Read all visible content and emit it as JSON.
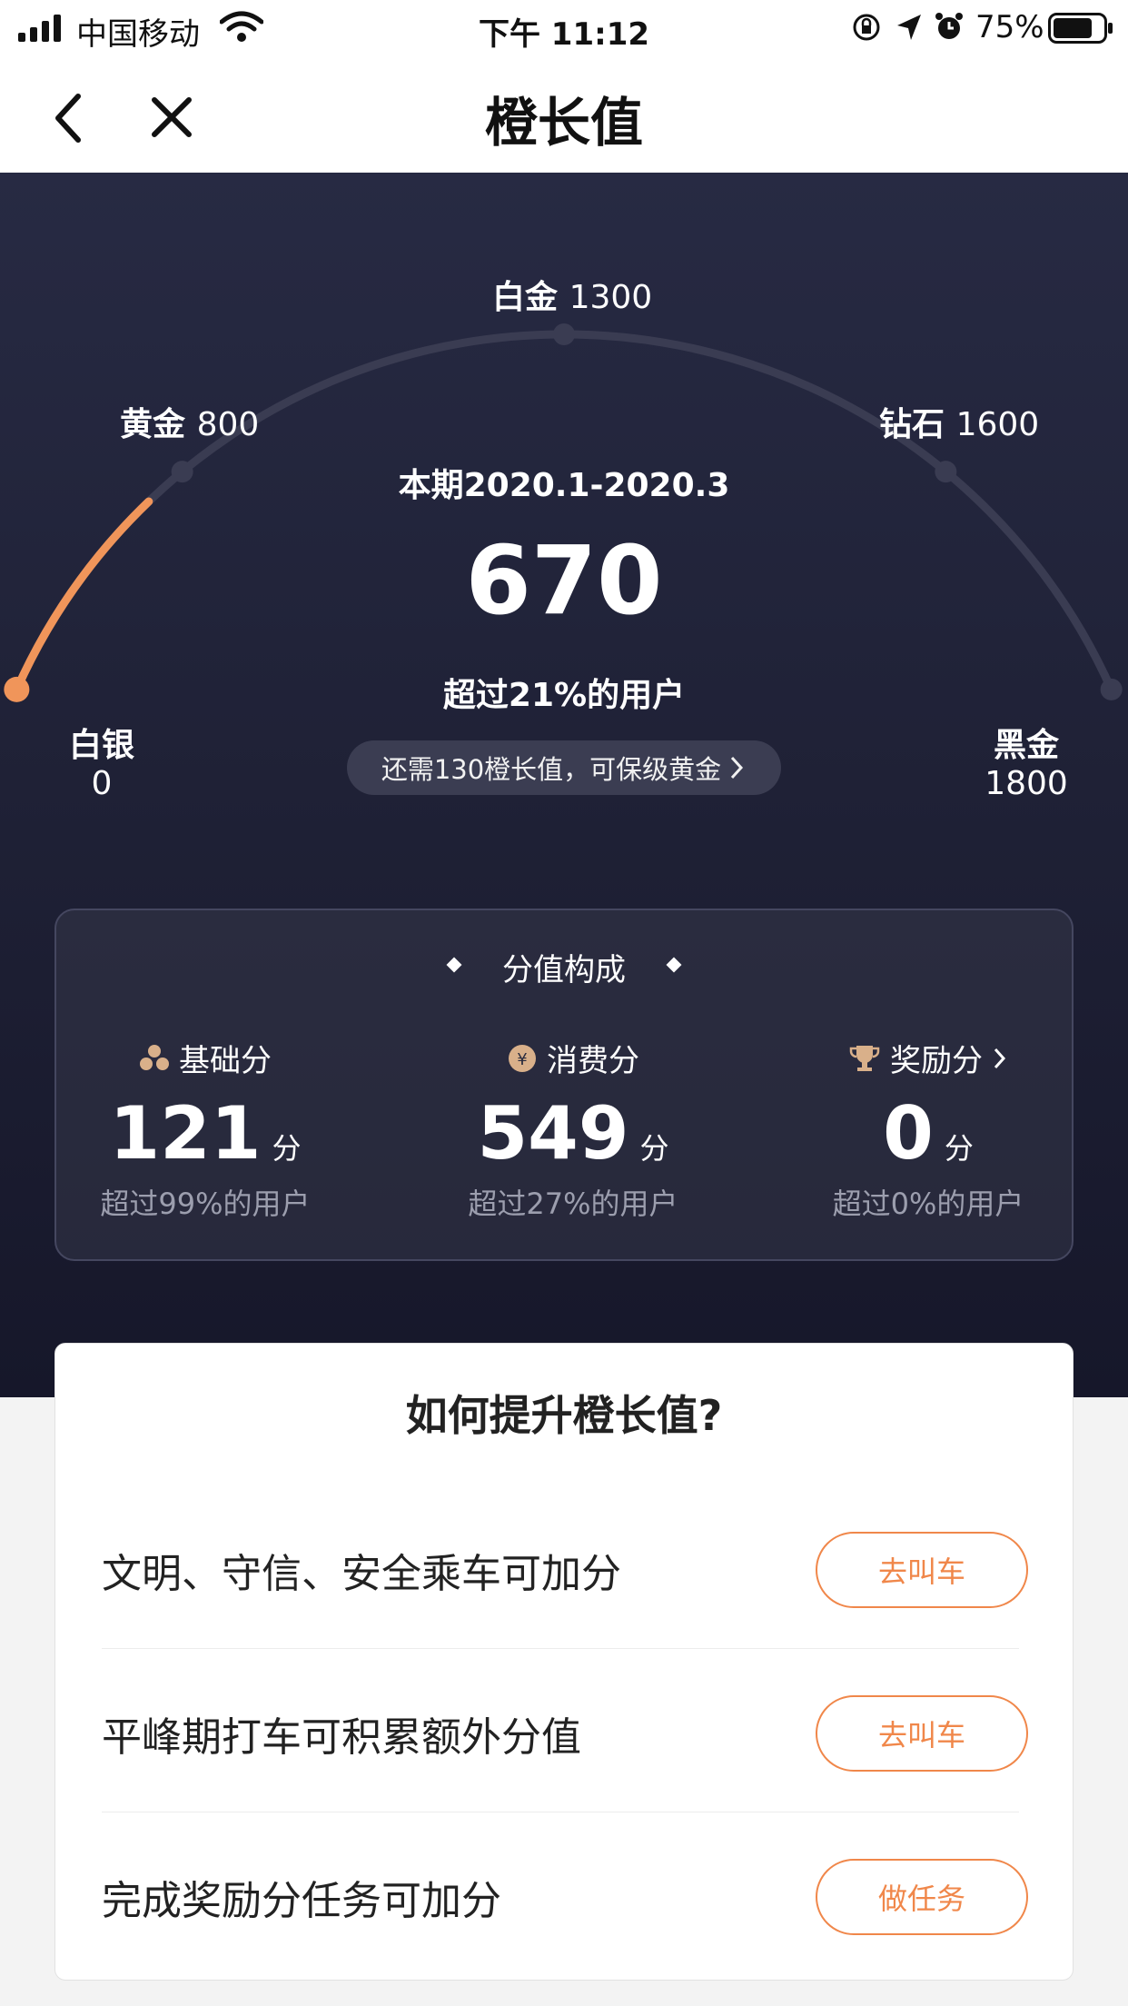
{
  "status_bar": {
    "carrier": "中国移动",
    "time": "下午 11:12",
    "battery": "75%"
  },
  "header": {
    "title": "橙长值"
  },
  "gauge": {
    "levels": [
      {
        "name": "白银",
        "value": "0"
      },
      {
        "name": "黄金",
        "value": "800"
      },
      {
        "name": "白金",
        "value": "1300"
      },
      {
        "name": "钻石",
        "value": "1600"
      },
      {
        "name": "黑金",
        "value": "1800"
      }
    ],
    "current_value": 670,
    "max_value": 1800,
    "colors": {
      "progress": "#f0955a",
      "track": "#3a3c52"
    }
  },
  "summary": {
    "period": "本期2020.1-2020.3",
    "score": "670",
    "exceed": "超过21%的用户",
    "upgrade_hint": "还需130橙长值，可保级黄金"
  },
  "breakdown": {
    "title": "分值构成",
    "unit": "分",
    "items": [
      {
        "label": "基础分",
        "value": "121",
        "sub": "超过99%的用户",
        "icon": "cubes-icon"
      },
      {
        "label": "消费分",
        "value": "549",
        "sub": "超过27%的用户",
        "icon": "yen-coin-icon"
      },
      {
        "label": "奖励分",
        "value": "0",
        "sub": "超过0%的用户",
        "icon": "trophy-icon"
      }
    ]
  },
  "improve": {
    "title": "如何提升橙长值?",
    "rows": [
      {
        "text": "文明、守信、安全乘车可加分",
        "button": "去叫车"
      },
      {
        "text": "平峰期打车可积累额外分值",
        "button": "去叫车"
      },
      {
        "text": "完成奖励分任务可加分",
        "button": "做任务"
      }
    ],
    "accent": "#f0874a"
  }
}
